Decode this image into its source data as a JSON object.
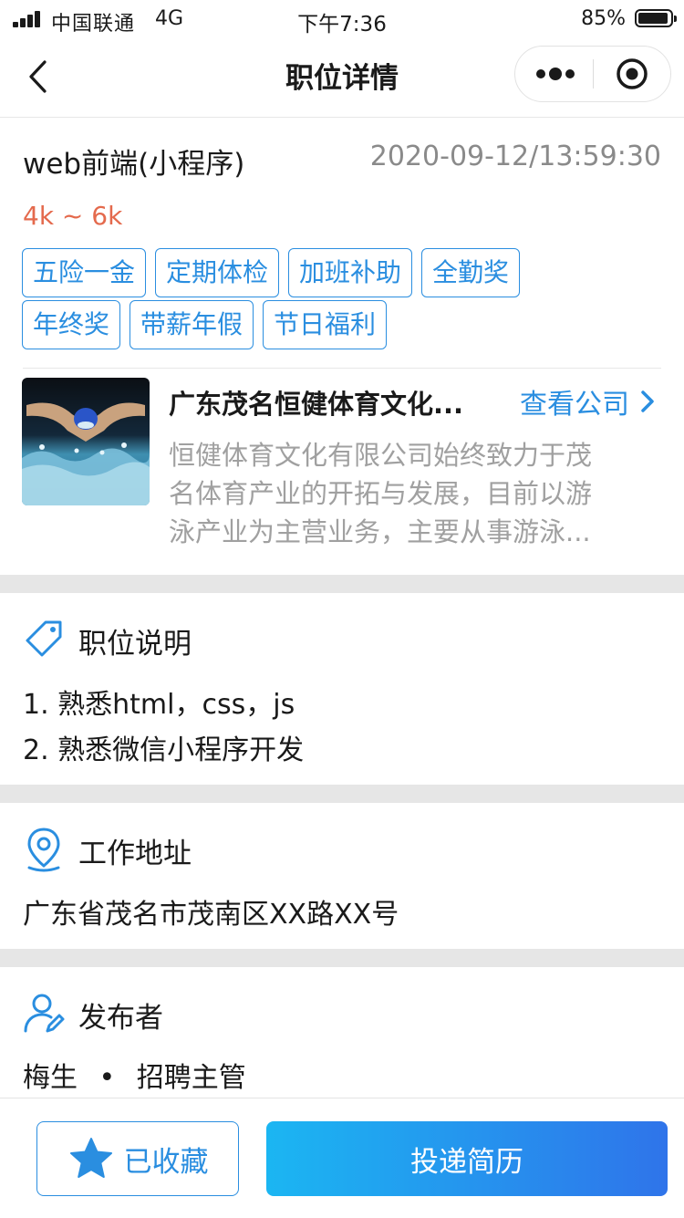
{
  "status_bar": {
    "carrier": "中国联通",
    "network": "4G",
    "time": "下午7:36",
    "battery": "85%"
  },
  "nav": {
    "title": "职位详情",
    "back_icon": "chevron-left-icon",
    "more_icon": "more-dots-icon",
    "close_icon": "target-icon"
  },
  "job": {
    "title": "web前端(小程序)",
    "time": "2020-09-12/13:59:30",
    "salary": "4k ~ 6k",
    "tags": [
      "五险一金",
      "定期体检",
      "加班补助",
      "全勤奖",
      "年终奖",
      "带薪年假",
      "节日福利"
    ]
  },
  "company": {
    "name": "广东茂名恒健体育文化...",
    "view_label": "查看公司",
    "desc_lines": [
      "恒健体育文化有限公司始终致力于茂",
      "名体育产业的开拓与发展，目前以游",
      "泳产业为主营业务，主要从事游泳..."
    ]
  },
  "description": {
    "title": "职位说明",
    "icon": "tag-icon",
    "lines": [
      "1. 熟悉html，css，js",
      "2. 熟悉微信小程序开发"
    ]
  },
  "address": {
    "title": "工作地址",
    "icon": "location-pin-icon",
    "text": "广东省茂名市茂南区XX路XX号"
  },
  "publisher": {
    "title": "发布者",
    "icon": "user-edit-icon",
    "name": "梅生",
    "separator": "•",
    "role": "招聘主管"
  },
  "actions": {
    "favorite_label": "已收藏",
    "apply_label": "投递简历"
  },
  "colors": {
    "accent": "#2a8ee0",
    "salary": "#e46a4d",
    "muted": "#8a8a8a",
    "apply_gradient_start": "#1bb6f2",
    "apply_gradient_end": "#2f74ea"
  }
}
